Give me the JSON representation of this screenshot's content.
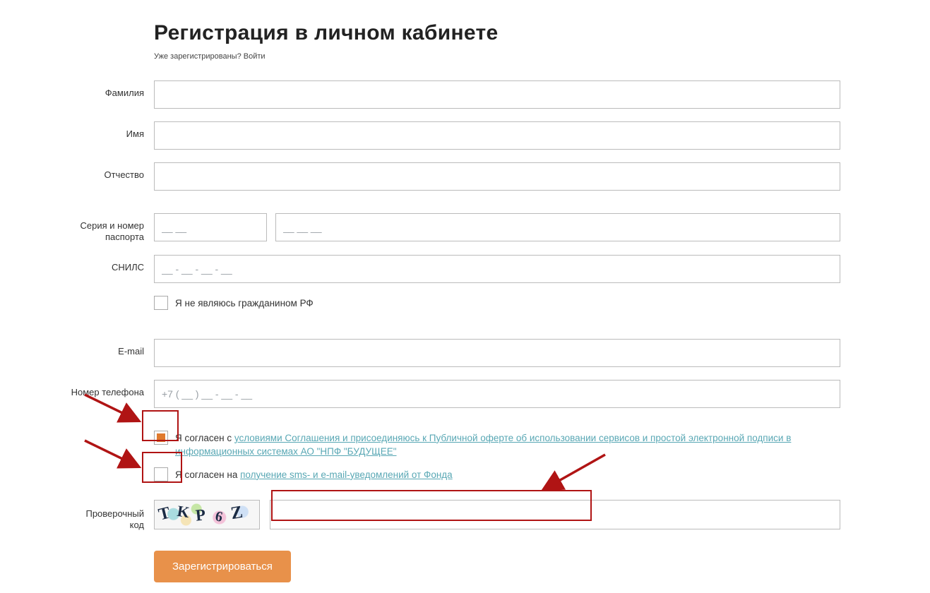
{
  "title": "Регистрация в личном кабинете",
  "login_prompt": {
    "text": "Уже зарегистрированы? ",
    "link": "Войти"
  },
  "labels": {
    "lastname": "Фамилия",
    "firstname": "Имя",
    "patronymic": "Отчество",
    "passport": "Серия и номер паспорта",
    "snils": "СНИЛС",
    "email": "E-mail",
    "phone": "Номер телефона",
    "captcha": "Проверочный код"
  },
  "placeholders": {
    "passport_series": "__ __",
    "passport_number": "__ __ __",
    "snils": "__ - __ - __ - __",
    "phone": "+7 ( __ ) __ - __ - __"
  },
  "checkboxes": {
    "not_rf": "Я не являюсь гражданином РФ",
    "agree1_prefix": "Я согласен с ",
    "agree1_link": "условиями Соглашения и присоединяюсь к Публичной оферте об использовании сервисов и простой электронной подписи в информационных системах АО \"НПФ \"БУДУЩЕЕ\"",
    "agree2_prefix": "Я согласен на ",
    "agree2_link": "получение sms- и e-mail-уведомлений от Фонда"
  },
  "captcha_text": "TKP6Z",
  "submit": "Зарегистрироваться"
}
